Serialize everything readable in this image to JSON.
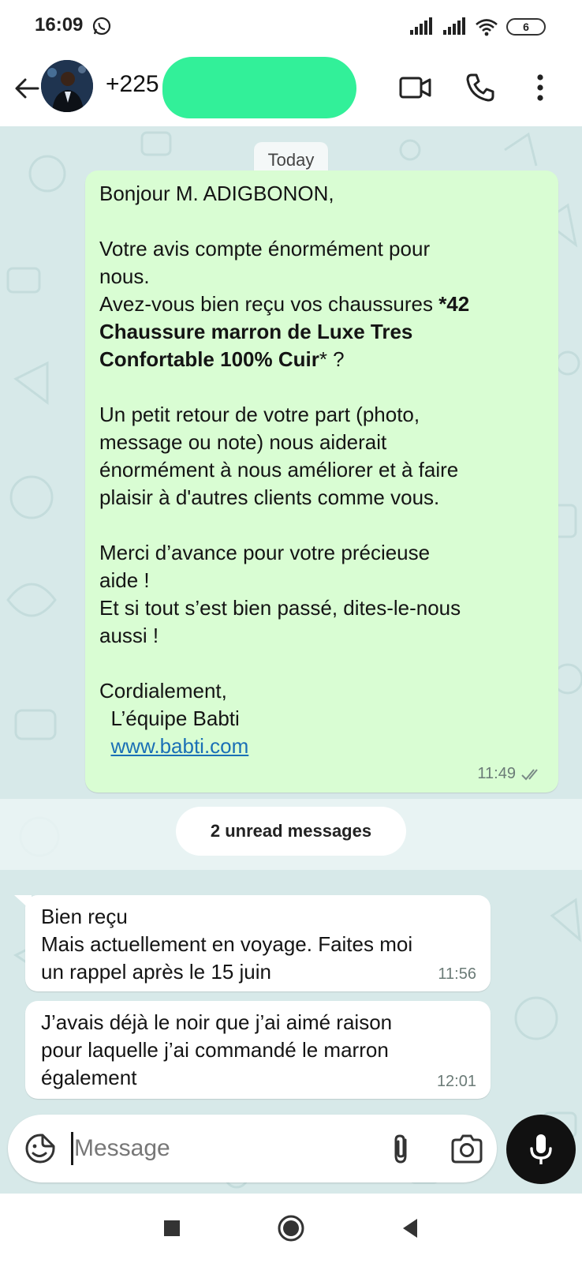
{
  "status_bar": {
    "time": "16:09",
    "battery": "6",
    "icons": [
      "whatsapp-icon",
      "signal-icon",
      "signal-icon",
      "wifi-icon",
      "battery-icon"
    ]
  },
  "header": {
    "contact": "+225",
    "icons": [
      "back-arrow-icon",
      "video-call-icon",
      "phone-icon",
      "more-vert-icon"
    ]
  },
  "chat": {
    "date_chip": "Today",
    "outgoing": {
      "line1": "Bonjour M. ADIGBONON,",
      "p2_l1": "Votre avis compte énormément pour",
      "p2_l2": "nous.",
      "p2_l3_a": "Avez-vous bien reçu vos chaussures ",
      "p2_l3_b": "*42",
      "p2_l4": "Chaussure marron de Luxe Tres",
      "p2_l5_b": "Confortable 100% Cuir",
      "p2_l5_a": "* ?",
      "p3_l1": "Un petit retour de votre part (photo,",
      "p3_l2": "message ou note) nous aiderait",
      "p3_l3": "énormément à nous améliorer et à faire",
      "p3_l4": "plaisir à d'autres clients comme vous.",
      "p4_l1": "Merci d’avance pour votre précieuse",
      "p4_l2": "aide !",
      "p4_l3": "Et si tout s’est bien passé, dites-le-nous",
      "p4_l4": "aussi !",
      "p5_l1": "Cordialement,",
      "p5_l2": "  L’équipe Babti",
      "p5_link": "www.babti.com",
      "time": "11:49"
    },
    "unread_label": "2 unread messages",
    "incoming": [
      {
        "l1": "Bien reçu",
        "l2": "Mais actuellement en voyage. Faites moi",
        "l3": "un rappel après le 15 juin",
        "time": "11:56"
      },
      {
        "l1": "J’avais déjà le noir que j’ai aimé raison",
        "l2": "pour laquelle j’ai commandé le marron",
        "l3": "également",
        "time": "12:01"
      }
    ]
  },
  "input": {
    "placeholder": "Message",
    "icons": [
      "emoji-icon",
      "attach-icon",
      "camera-icon",
      "mic-icon"
    ]
  },
  "nav": {
    "icons": [
      "recents-square-icon",
      "home-circle-icon",
      "back-triangle-icon"
    ]
  },
  "colors": {
    "outgoing_bubble": "#d9fdd3",
    "incoming_bubble": "#ffffff",
    "chat_background": "#d7e9e9",
    "redaction": "#32f099",
    "link": "#1a6fb6"
  }
}
